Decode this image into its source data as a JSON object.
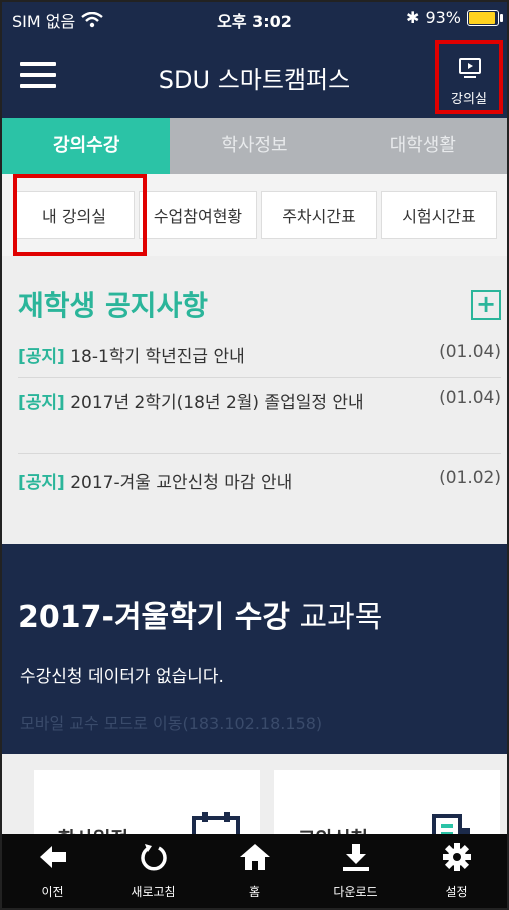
{
  "status": {
    "carrier": "SIM 없음",
    "time": "오후 3:02",
    "battery": "93%"
  },
  "header": {
    "title": "SDU 스마트캠퍼스",
    "classroom_label": "강의실"
  },
  "tabs": [
    "강의수강",
    "학사정보",
    "대학생활"
  ],
  "subtabs": [
    "내 강의실",
    "수업참여현황",
    "주차시간표",
    "시험시간표"
  ],
  "notices": {
    "title": "재학생 공지사항",
    "items": [
      {
        "tag": "[공지]",
        "text": "18-1학기 학년진급 안내",
        "date": "(01.04)"
      },
      {
        "tag": "[공지]",
        "text": "2017년 2학기(18년 2월) 졸업일정 안내",
        "date": "(01.04)"
      },
      {
        "tag": "[공지]",
        "text": "2017-겨울 교안신청 마감 안내",
        "date": "(01.02)"
      }
    ]
  },
  "course": {
    "title_bold": "2017-겨울학기 수강",
    "title_rest": "교과목",
    "message": "수강신청 데이터가 없습니다.",
    "link": "모바일 교수 모드로 이동(183.102.18.158)"
  },
  "cards": [
    "학사일정",
    "교안신청"
  ],
  "bottom_nav": [
    "이전",
    "새로고침",
    "홈",
    "다운로드",
    "설정"
  ],
  "colors": {
    "navy": "#1b2a4a",
    "accent": "#2bc3a6",
    "highlight": "#e00000"
  }
}
